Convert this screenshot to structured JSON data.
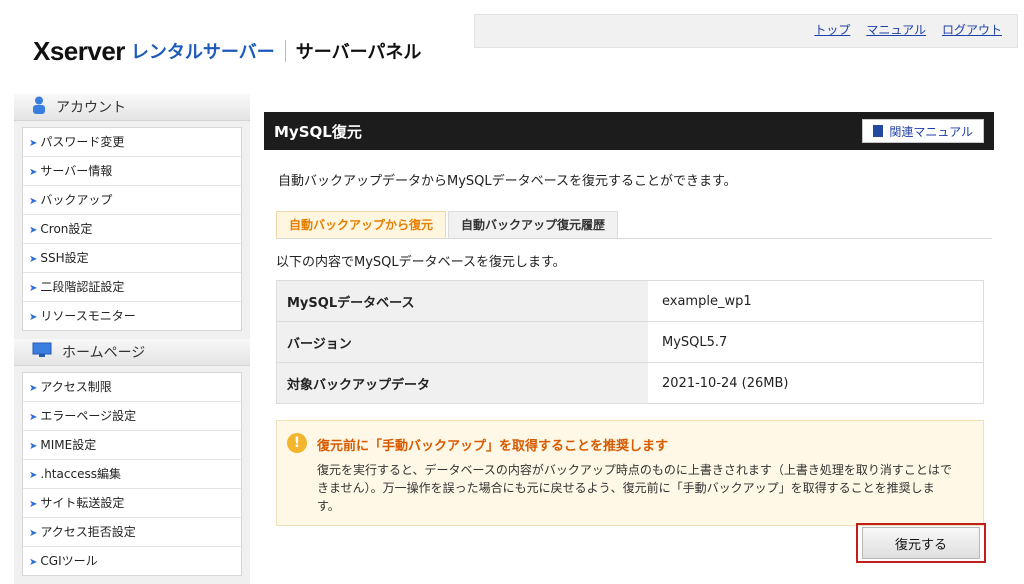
{
  "header": {
    "logo_xserver": "Xserver",
    "logo_rental": "レンタルサーバー",
    "logo_panel": "サーバーパネル",
    "links": [
      "トップ",
      "マニュアル",
      "ログアウト"
    ]
  },
  "sidebar": {
    "sections": [
      {
        "title": "アカウント",
        "icon": "user-icon",
        "items": [
          "パスワード変更",
          "サーバー情報",
          "バックアップ",
          "Cron設定",
          "SSH設定",
          "二段階認証設定",
          "リソースモニター"
        ]
      },
      {
        "title": "ホームページ",
        "icon": "monitor-icon",
        "items": [
          "アクセス制限",
          "エラーページ設定",
          "MIME設定",
          ".htaccess編集",
          "サイト転送設定",
          "アクセス拒否設定",
          "CGIツール"
        ]
      }
    ]
  },
  "main": {
    "title": "MySQL復元",
    "manual_button": "関連マニュアル",
    "intro": "自動バックアップデータからMySQLデータベースを復元することができます。",
    "tabs": [
      "自動バックアップから復元",
      "自動バックアップ復元履歴"
    ],
    "active_tab": 0,
    "description": "以下の内容でMySQLデータベースを復元します。",
    "table": [
      {
        "label": "MySQLデータベース",
        "value": "example_wp1"
      },
      {
        "label": "バージョン",
        "value": "MySQL5.7"
      },
      {
        "label": "対象バックアップデータ",
        "value": "2021-10-24 (26MB)"
      }
    ],
    "warning": {
      "title": "復元前に「手動バックアップ」を取得することを推奨します",
      "body": "復元を実行すると、データベースの内容がバックアップ時点のものに上書きされます（上書き処理を取り消すことはできません）。万一操作を誤った場合にも元に戻せるよう、復元前に「手動バックアップ」を取得することを推奨します。"
    },
    "restore_button": "復元する"
  },
  "colors": {
    "accent_orange": "#e67e00",
    "title_bar": "#1c1c1c",
    "highlight_red": "#c21e1e",
    "link_blue": "#1f3fa8"
  }
}
